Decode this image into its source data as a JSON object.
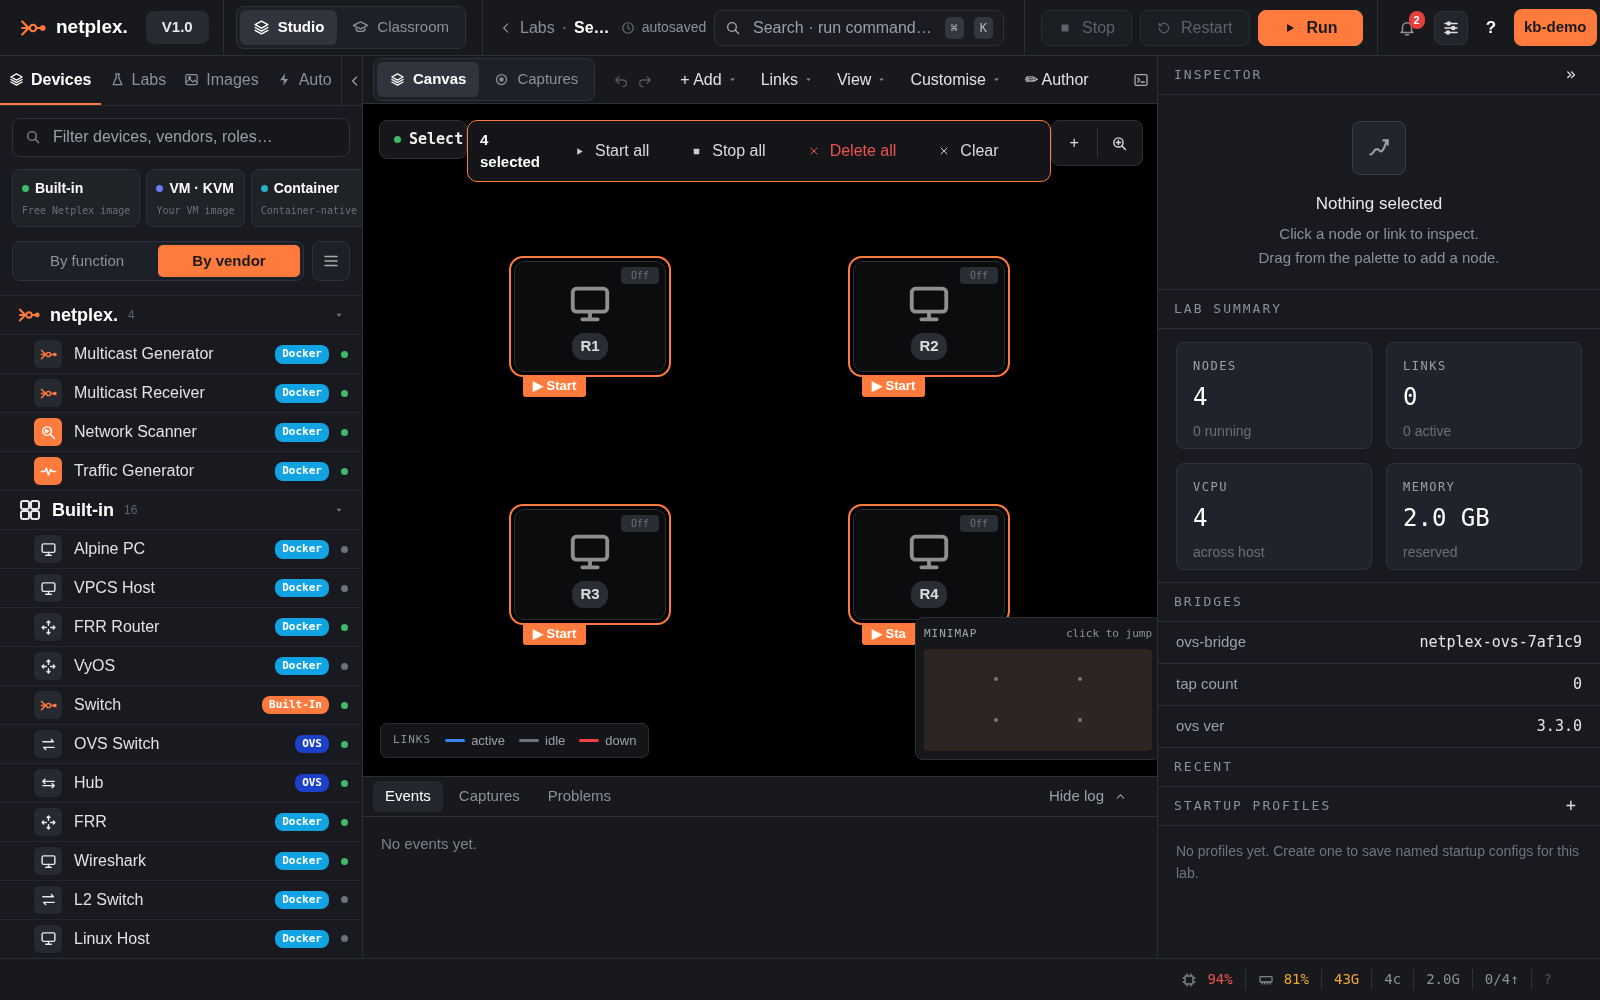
{
  "app": {
    "brand": "netplex.",
    "version": "V1.0"
  },
  "modes": [
    {
      "label": "Studio",
      "selected": true
    },
    {
      "label": "Classroom",
      "selected": false
    }
  ],
  "breadcrumb": {
    "back": "Labs",
    "separator": "·",
    "current": "Se…",
    "status": "autosaved"
  },
  "search": {
    "placeholder": "Search · run command…",
    "keys": [
      "⌘",
      "K"
    ]
  },
  "actions": [
    {
      "label": "Stop",
      "kind": "stop",
      "disabled": true
    },
    {
      "label": "Restart",
      "kind": "restart",
      "disabled": true
    },
    {
      "label": "Run",
      "kind": "run",
      "disabled": false
    }
  ],
  "notifications": {
    "count": "2"
  },
  "help": "?",
  "user": "kb-demo",
  "sidebar": {
    "tabs": [
      {
        "label": "Devices",
        "selected": true
      },
      {
        "label": "Labs",
        "selected": false
      },
      {
        "label": "Images",
        "selected": false
      },
      {
        "label": "Auto",
        "selected": false
      }
    ],
    "filter_placeholder": "Filter devices, vendors, roles…",
    "sources": [
      {
        "title": "Built-in",
        "subtitle": "Free Netplex image",
        "color": "#3fb96a"
      },
      {
        "title": "VM · KVM",
        "subtitle": "Your VM image",
        "color": "#6b7cf6"
      },
      {
        "title": "Container",
        "subtitle": "Container-native",
        "color": "#22b5c8"
      }
    ],
    "grouping": [
      {
        "label": "By function",
        "selected": false
      },
      {
        "label": "By vendor",
        "selected": true
      }
    ],
    "groups": [
      {
        "name": "netplex.",
        "count": "4",
        "kind": "brand",
        "items": [
          {
            "name": "Multicast Generator",
            "kind": "brand",
            "tag": {
              "text": "Docker",
              "color": "#12a3e3"
            },
            "online": true
          },
          {
            "name": "Multicast Receiver",
            "kind": "brand",
            "tag": {
              "text": "Docker",
              "color": "#12a3e3"
            },
            "online": true
          },
          {
            "name": "Network Scanner",
            "kind": "scanner",
            "tag": {
              "text": "Docker",
              "color": "#12a3e3"
            },
            "online": true
          },
          {
            "name": "Traffic Generator",
            "kind": "traffic",
            "tag": {
              "text": "Docker",
              "color": "#12a3e3"
            },
            "online": true
          }
        ]
      },
      {
        "name": "Built-in",
        "count": "16",
        "kind": "grid",
        "items": [
          {
            "name": "Alpine PC",
            "kind": "monitor",
            "tag": {
              "text": "Docker",
              "color": "#12a3e3"
            },
            "online": false
          },
          {
            "name": "VPCS Host",
            "kind": "monitor",
            "tag": {
              "text": "Docker",
              "color": "#12a3e3"
            },
            "online": false
          },
          {
            "name": "FRR Router",
            "kind": "router",
            "tag": {
              "text": "Docker",
              "color": "#12a3e3"
            },
            "online": true
          },
          {
            "name": "VyOS",
            "kind": "router",
            "tag": {
              "text": "Docker",
              "color": "#12a3e3"
            },
            "online": false
          },
          {
            "name": "Switch",
            "kind": "brand",
            "tag": {
              "text": "Built-In",
              "color": "#ff7a3d"
            },
            "online": true
          },
          {
            "name": "OVS Switch",
            "kind": "swap",
            "tag": {
              "text": "OVS",
              "color": "#1d40c8"
            },
            "online": true
          },
          {
            "name": "Hub",
            "kind": "hub",
            "tag": {
              "text": "OVS",
              "color": "#1d40c8"
            },
            "online": true
          },
          {
            "name": "FRR",
            "kind": "router",
            "tag": {
              "text": "Docker",
              "color": "#12a3e3"
            },
            "online": true
          },
          {
            "name": "Wireshark",
            "kind": "monitor",
            "tag": {
              "text": "Docker",
              "color": "#12a3e3"
            },
            "online": true
          },
          {
            "name": "L2 Switch",
            "kind": "swap",
            "tag": {
              "text": "Docker",
              "color": "#12a3e3"
            },
            "online": false
          },
          {
            "name": "Linux Host",
            "kind": "monitor",
            "tag": {
              "text": "Docker",
              "color": "#12a3e3"
            },
            "online": false
          }
        ]
      }
    ]
  },
  "canvas_toolbar": {
    "views": [
      {
        "label": "Canvas",
        "selected": true
      },
      {
        "label": "Captures",
        "selected": false
      }
    ],
    "menus": [
      {
        "label": "+ Add",
        "dropdown": true
      },
      {
        "label": "Links",
        "dropdown": true
      },
      {
        "label": "View",
        "dropdown": true
      },
      {
        "label": "Customise",
        "dropdown": true
      },
      {
        "label": "✏ Author",
        "dropdown": false
      }
    ]
  },
  "selection": {
    "mode": "Select",
    "count": "4 selected",
    "zoom_add": "+",
    "actions": [
      {
        "label": "Start all",
        "kind": "start"
      },
      {
        "label": "Stop all",
        "kind": "stop"
      },
      {
        "label": "Delete all",
        "kind": "delete"
      },
      {
        "label": "Clear",
        "kind": "clear"
      }
    ]
  },
  "nodes": [
    {
      "label": "R1",
      "state": "Off",
      "selected": true,
      "start": "▶ Start"
    },
    {
      "label": "R2",
      "state": "Off",
      "selected": true,
      "start": "▶ Start"
    },
    {
      "label": "R3",
      "state": "Off",
      "selected": true,
      "start": "▶ Start"
    },
    {
      "label": "R4",
      "state": "Off",
      "selected": true,
      "start": "▶ Sta"
    }
  ],
  "legend": {
    "title": "LINKS",
    "items": [
      {
        "label": "active",
        "color": "#3b82f6"
      },
      {
        "label": "idle",
        "color": "#6b7280"
      },
      {
        "label": "down",
        "color": "#ef4444"
      }
    ]
  },
  "minimap": {
    "title": "MINIMAP",
    "hint": "click to jump"
  },
  "log": {
    "tabs": [
      {
        "label": "Events",
        "selected": true
      },
      {
        "label": "Captures",
        "selected": false
      },
      {
        "label": "Problems",
        "selected": false
      }
    ],
    "toggle": "Hide log",
    "empty": "No events yet."
  },
  "inspector": {
    "title": "INSPECTOR",
    "collapse": "»",
    "empty_title": "Nothing selected",
    "hints": [
      "Click a node or link to inspect.",
      "Drag from the palette to add a node."
    ]
  },
  "lab_summary": {
    "title": "LAB SUMMARY",
    "stats": [
      {
        "label": "NODES",
        "value": "4",
        "note": "0 running"
      },
      {
        "label": "LINKS",
        "value": "0",
        "note": "0 active"
      },
      {
        "label": "VCPU",
        "value": "4",
        "note": "across host"
      },
      {
        "label": "MEMORY",
        "value": "2.0 GB",
        "note": "reserved"
      }
    ]
  },
  "bridges": {
    "title": "BRIDGES",
    "rows": [
      {
        "key": "ovs-bridge",
        "value": "netplex-ovs-7af1c9"
      },
      {
        "key": "tap count",
        "value": "0"
      },
      {
        "key": "ovs ver",
        "value": "3.3.0"
      }
    ]
  },
  "recent": {
    "title": "RECENT"
  },
  "startup_profiles": {
    "title": "STARTUP PROFILES",
    "add": "+",
    "empty": "No profiles yet. Create one to save named startup configs for this lab."
  },
  "status_bar": [
    {
      "kind": "cpu",
      "text": "94%",
      "color": "#ef5350"
    },
    {
      "kind": "memory",
      "text": "81%",
      "color": "#f0a830"
    },
    {
      "kind": "plain",
      "text": "43G",
      "color": "#f0a830"
    },
    {
      "kind": "plain",
      "text": "4c",
      "color": "#8b9099"
    },
    {
      "kind": "plain",
      "text": "2.0G",
      "color": "#8b9099"
    },
    {
      "kind": "plain",
      "text": "0/4↑",
      "color": "#8b9099"
    },
    {
      "kind": "plain",
      "text": "?",
      "color": "#4f545c"
    }
  ]
}
